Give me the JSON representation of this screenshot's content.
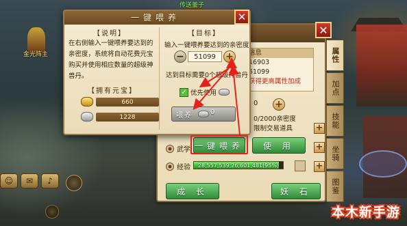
{
  "scene": {
    "npc_top_label": "传送董子",
    "npc_left_label": "金光阵主",
    "watermark": "本木新手游"
  },
  "dialog": {
    "title": "一键喂养",
    "close_label": "✕",
    "description_heading": "【说明】",
    "description_text": "在右侧输入一键喂养要达到的亲密度，系统将自动花费元宝购买并使用相应数量的超级神兽丹。",
    "owned_heading": "【拥有元宝】",
    "gold_amount": "660",
    "silver_amount": "1228",
    "target_heading": "【目标】",
    "target_prompt": "输入一键喂养要达到的亲密度",
    "stepper_minus": "−",
    "stepper_value": "51099",
    "stepper_plus": "+",
    "requirement_text": "达到目标需要0个超级神兽丹",
    "priority_label": "优先使用",
    "feed_button_label": "喂养",
    "feed_cost": "0"
  },
  "char_panel": {
    "close_label": "✕",
    "tabs": [
      "属性",
      "加点",
      "技能",
      "坐骑",
      "图鉴"
    ],
    "info": {
      "title": "信息",
      "line1": "16903",
      "line2": "51099",
      "line3": "获得更高属性加成"
    },
    "qty_value": "0",
    "qty_plus": "+",
    "qty_line1": "0",
    "qty_line2": "0/2000亲密度",
    "qty_line3": "限制交易道具",
    "wuxue_label": "武学",
    "one_click_feed_button": "一键喂养",
    "use_button": "使 用",
    "exp_label": "经验",
    "exp_text": "28,557,539,26,601,481(95%)",
    "exp_percent": 95,
    "grow_button": "成 长",
    "yaoshi_button": "妖 石",
    "plus_label": "+"
  },
  "chat_icons": [
    "☺",
    "✉",
    "♪"
  ],
  "colors": {
    "highlight": "#e6201a",
    "green_button": "#2f8a3a",
    "panel_bg": "#f4e9cf",
    "title_bar": "#7a5a30"
  }
}
